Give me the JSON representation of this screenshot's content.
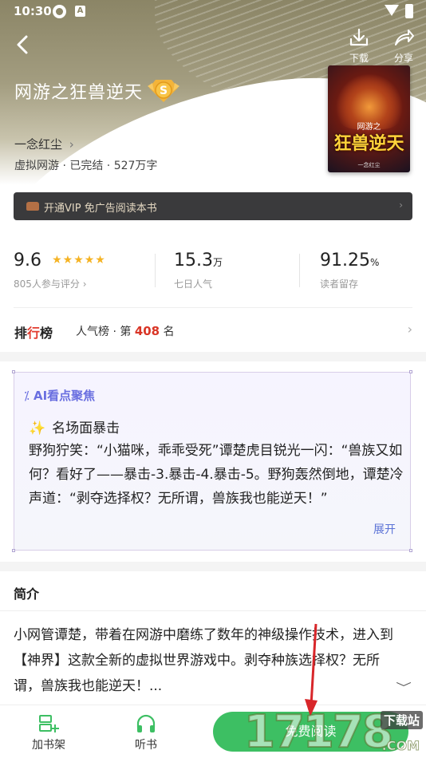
{
  "status_bar": {
    "time": "10:30"
  },
  "header": {
    "download_label": "下载",
    "share_label": "分享"
  },
  "book": {
    "title": "网游之狂兽逆天",
    "badge": "S",
    "author": "一念红尘",
    "author_arrow": "›",
    "meta": "虚拟网游 · 已完结 · 527万字",
    "cover": {
      "title_top": "网游之",
      "title": "狂兽逆天"
    }
  },
  "vip_banner": {
    "text": "开通VIP 免广告阅读本书",
    "arrow": "›"
  },
  "stats": {
    "rating": {
      "value": "9.6",
      "stars": "★★★★★",
      "label": "805人参与评分 ›"
    },
    "popularity": {
      "value": "15.3",
      "unit": "万",
      "label": "七日人气"
    },
    "retention": {
      "value": "91.25",
      "unit": "%",
      "label": "读者留存"
    }
  },
  "ranking": {
    "label_a": "排",
    "label_b": "行",
    "label_c": "榜",
    "list_name": "人气榜 · 第 ",
    "rank": "408",
    "suffix": " 名",
    "arrow": "›"
  },
  "ai_focus": {
    "heading": "AI看点聚焦",
    "subtitle": "名场面暴击",
    "body": "野狗狞笑：“小猫咪，乖乖受死”谭楚虎目锐光一闪：“兽族又如何？看好了——暴击-3.暴击-4.暴击-5。野狗轰然倒地，谭楚冷声道：“剥夺选择权？无所谓，兽族我也能逆天！”",
    "expand_label": "展开"
  },
  "intro": {
    "heading": "简介",
    "text": "小网管谭楚，带着在网游中磨练了数年的神级操作技术，进入到【神界】这款全新的虚拟世界游戏中。剥夺种族选择权？无所谓，兽族我也能逆天！..."
  },
  "bottom_bar": {
    "add_shelf": "加书架",
    "listen": "听书",
    "read": "免费阅读"
  },
  "watermark": {
    "digits": "17178",
    "tag": "下载站",
    "com": ".COM"
  },
  "colors": {
    "accent_green": "#3dbf63",
    "rank_red": "#d93526",
    "ai_blue": "#6a6fe0",
    "star_gold": "#f5b323"
  }
}
